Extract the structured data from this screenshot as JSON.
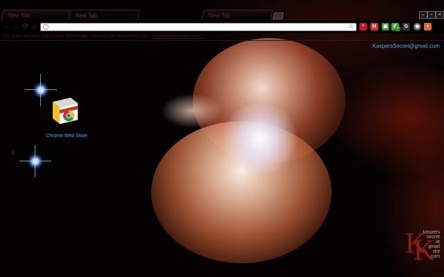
{
  "browser": {
    "tabs": [
      {
        "label": "New Tab",
        "active": false
      },
      {
        "label": "New Tab",
        "active": true
      },
      {
        "label": "New Tab",
        "active": false
      }
    ],
    "window_controls": [
      "–",
      "▫",
      "×"
    ],
    "toolbar": {
      "back_icon": "←",
      "forward_icon": "→",
      "reload_icon": "⟳",
      "home_icon": "⌂",
      "omnibox_value": "",
      "bookmark_star": "☆"
    },
    "extensions": [
      {
        "name": "lastpass-icon",
        "glyph": "*",
        "color": "#c8102e"
      },
      {
        "name": "gmail-icon",
        "glyph": "M",
        "color": "#d03a2a"
      },
      {
        "name": "photo-icon",
        "glyph": "▣",
        "color": "#3f8a3a"
      },
      {
        "name": "evernote-icon",
        "glyph": "E",
        "color": "#4f9a3a"
      },
      {
        "name": "green-ext-icon",
        "glyph": "✓",
        "color": "#2a8a2a"
      },
      {
        "name": "google-icon",
        "glyph": "G",
        "color": "#333333"
      },
      {
        "name": "world-icon",
        "glyph": "◉",
        "color": "#666666"
      },
      {
        "name": "addon-icon",
        "glyph": "+",
        "color": "#e8602a"
      }
    ],
    "bookmarks_bar": {
      "text": "For quick access, place your bookmarks here on the bookmarks bar.",
      "link": "Import bookmarks now..."
    }
  },
  "ntp": {
    "user_email": "KaspersSecret@gmail.com",
    "apps": [
      {
        "label": "Chrome Web Store"
      }
    ],
    "nav_left": "‹",
    "watermark": {
      "monogram": "K",
      "lines": [
        "kaspers",
        "secret",
        "at",
        "gmail",
        "dot",
        "com"
      ]
    }
  }
}
